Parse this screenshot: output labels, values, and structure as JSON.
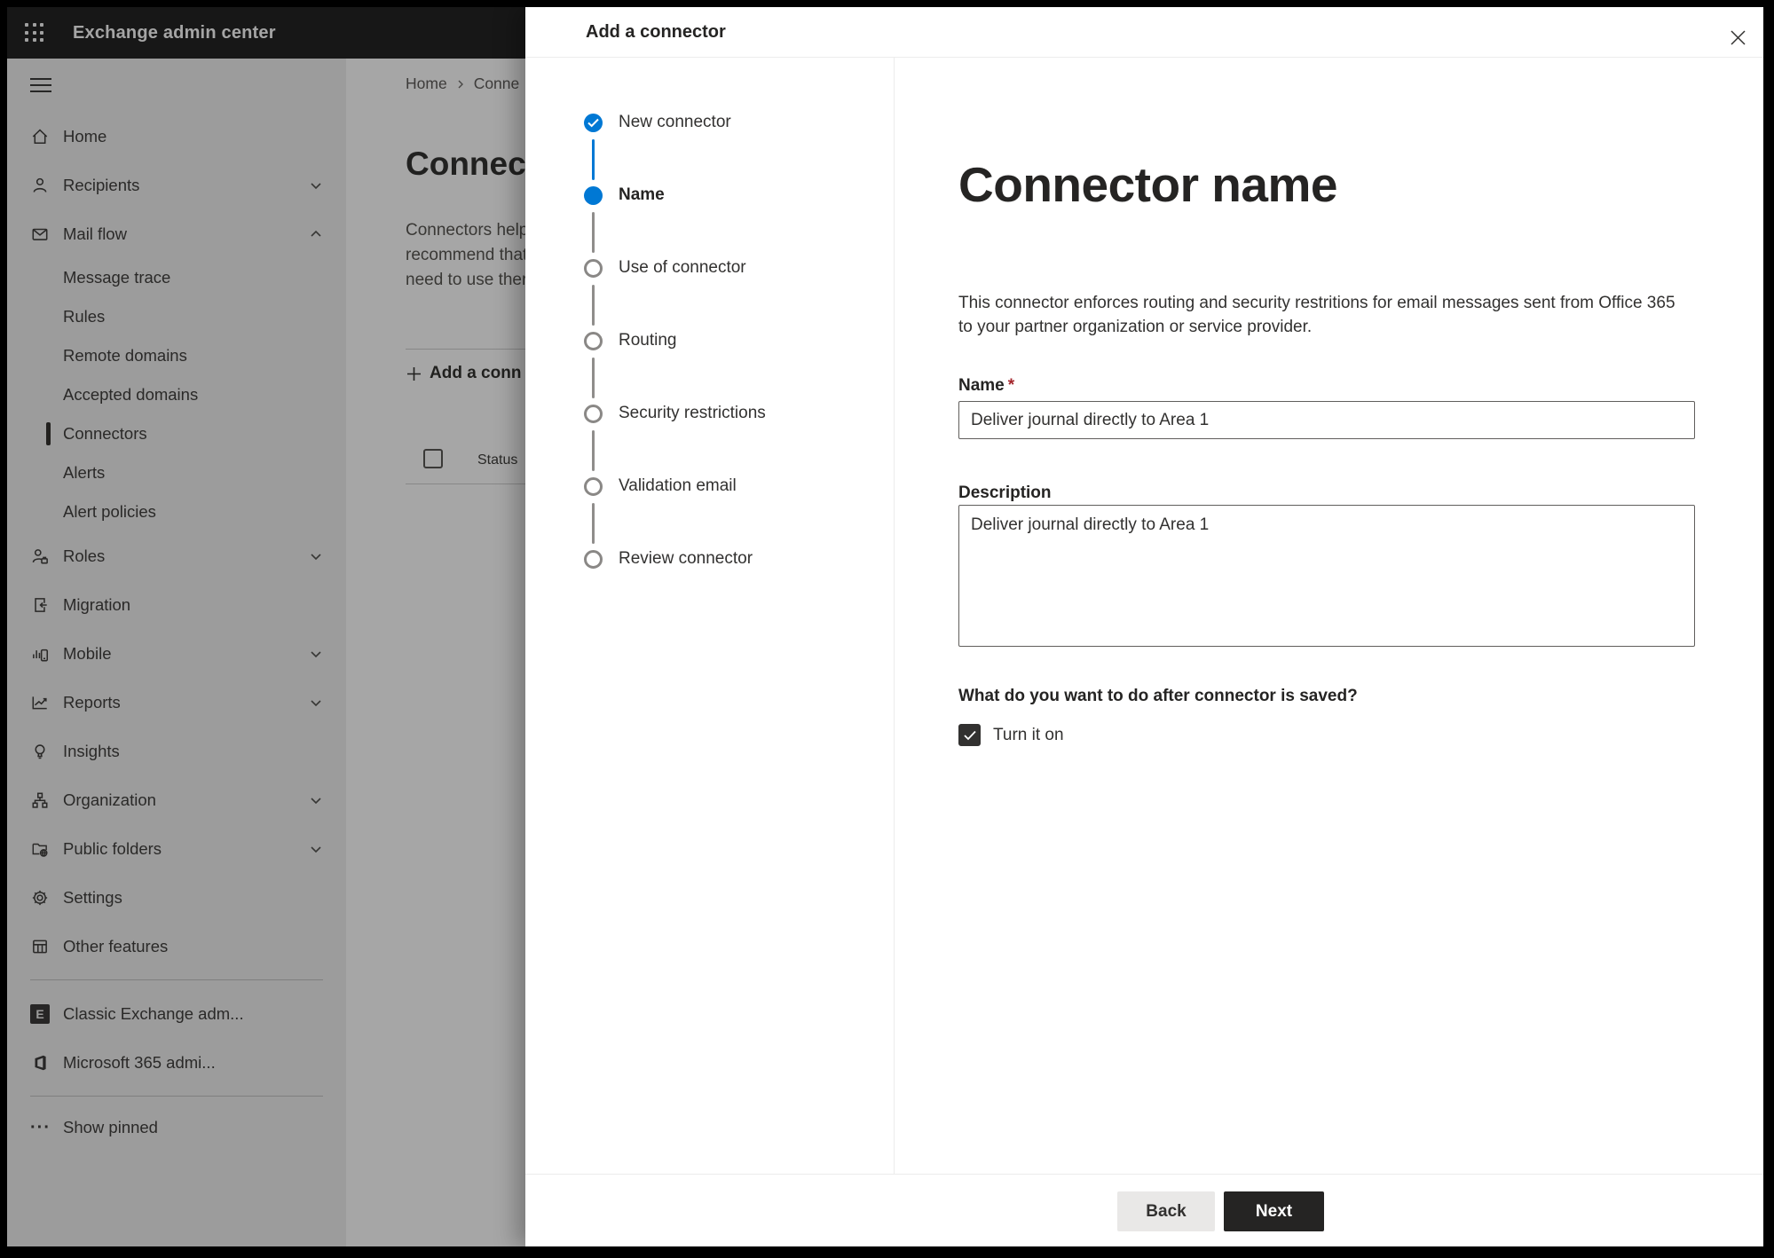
{
  "topbar": {
    "title": "Exchange admin center"
  },
  "sidebar": {
    "items": [
      {
        "label": "Home"
      },
      {
        "label": "Recipients"
      },
      {
        "label": "Mail flow"
      },
      {
        "label": "Message trace"
      },
      {
        "label": "Rules"
      },
      {
        "label": "Remote domains"
      },
      {
        "label": "Accepted domains"
      },
      {
        "label": "Connectors"
      },
      {
        "label": "Alerts"
      },
      {
        "label": "Alert policies"
      },
      {
        "label": "Roles"
      },
      {
        "label": "Migration"
      },
      {
        "label": "Mobile"
      },
      {
        "label": "Reports"
      },
      {
        "label": "Insights"
      },
      {
        "label": "Organization"
      },
      {
        "label": "Public folders"
      },
      {
        "label": "Settings"
      },
      {
        "label": "Other features"
      },
      {
        "label": "Classic Exchange adm..."
      },
      {
        "label": "Microsoft 365 admi..."
      },
      {
        "label": "Show pinned"
      }
    ]
  },
  "page": {
    "breadcrumb": {
      "home": "Home",
      "current": "Conne"
    },
    "title": "Connect",
    "paragraph_lines": [
      "Connectors help",
      "recommend that",
      "need to use ther"
    ],
    "add_button_label": "Add a conn",
    "table": {
      "status_header": "Status"
    }
  },
  "dialog": {
    "title": "Add a connector",
    "steps": [
      {
        "label": "New connector",
        "state": "completed"
      },
      {
        "label": "Name",
        "state": "current"
      },
      {
        "label": "Use of connector",
        "state": "upcoming"
      },
      {
        "label": "Routing",
        "state": "upcoming"
      },
      {
        "label": "Security restrictions",
        "state": "upcoming"
      },
      {
        "label": "Validation email",
        "state": "upcoming"
      },
      {
        "label": "Review connector",
        "state": "upcoming"
      }
    ],
    "content": {
      "heading": "Connector name",
      "lead_line1": "This connector enforces routing and security restritions for email messages sent from Office 365",
      "lead_line2": "to your partner organization or service provider.",
      "name_label": "Name",
      "required_mark": "*",
      "name_value": "Deliver journal directly to Area 1",
      "description_label": "Description",
      "description_value": "Deliver journal directly to Area 1",
      "question": "What do you want to do after connector is saved?",
      "checkbox_label": "Turn it on",
      "checkbox_checked": true
    },
    "footer": {
      "back_label": "Back",
      "next_label": "Next"
    }
  },
  "colors": {
    "accent_blue": "#0078d4",
    "required_red": "#a4262c",
    "next_button": "#252423",
    "topbar": "#232323"
  }
}
